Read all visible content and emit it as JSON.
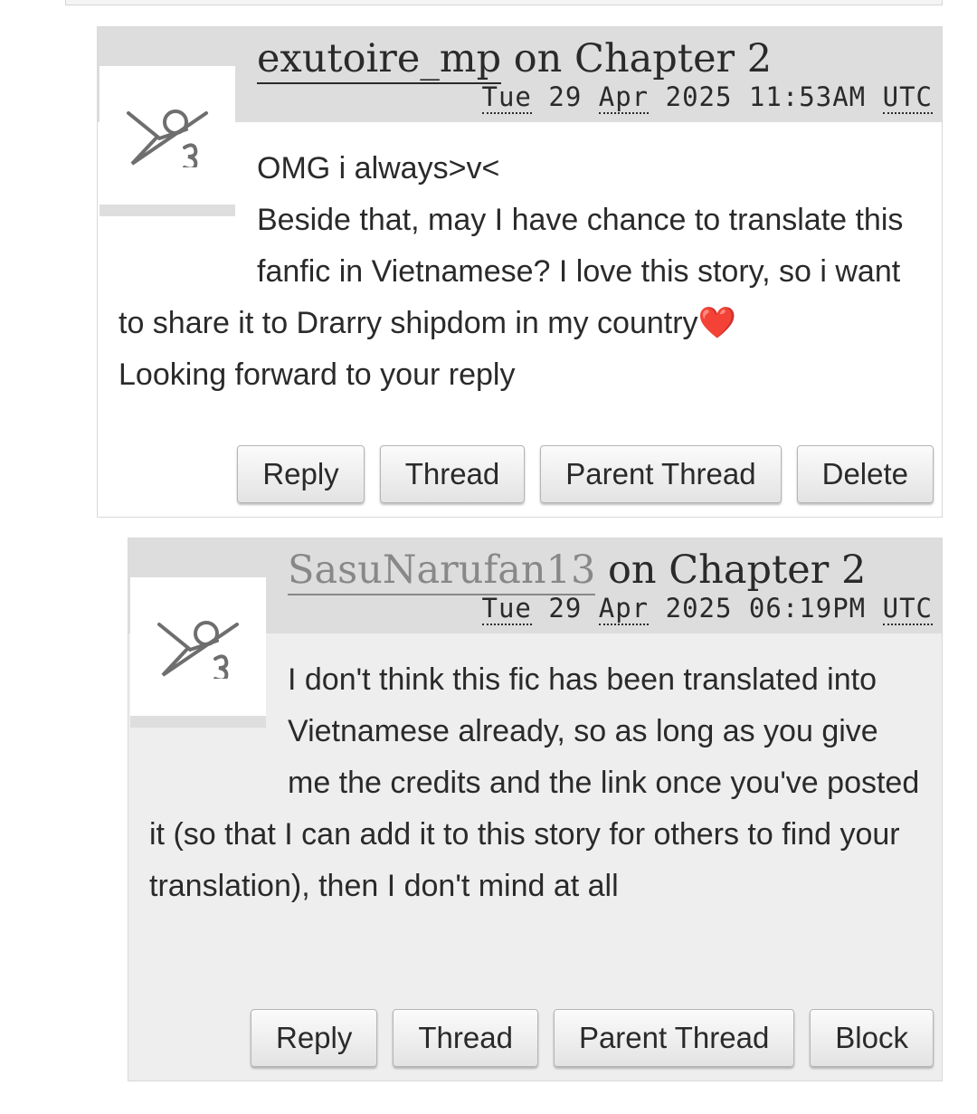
{
  "comments": [
    {
      "username": "exutoire_mp",
      "on_text": " on ",
      "chapter": "Chapter 2",
      "date": {
        "day": "Tue",
        "date": "29",
        "month": "Apr",
        "year": "2025",
        "time": "11:53AM",
        "tz": "UTC"
      },
      "body_lines": [
        "OMG i always>v<",
        "Beside that, may I have chance to translate this fanfic in Vietnamese? I love this story, so i want to share it to Drarry shipdom in my country",
        "Looking forward to your reply"
      ],
      "emoji": "❤️",
      "actions": [
        "Reply",
        "Thread",
        "Parent Thread",
        "Delete"
      ]
    },
    {
      "username": "SasuNarufan13",
      "on_text": " on ",
      "chapter": "Chapter 2",
      "date": {
        "day": "Tue",
        "date": "29",
        "month": "Apr",
        "year": "2025",
        "time": "06:19PM",
        "tz": "UTC"
      },
      "body_lines": [
        "I don't think this fic has been translated into Vietnamese already, so as long as you give me the credits and the link once you've posted it (so that I can add it to this story for others to find your translation), then I don't mind at all"
      ],
      "actions": [
        "Reply",
        "Thread",
        "Parent Thread",
        "Block"
      ]
    }
  ]
}
